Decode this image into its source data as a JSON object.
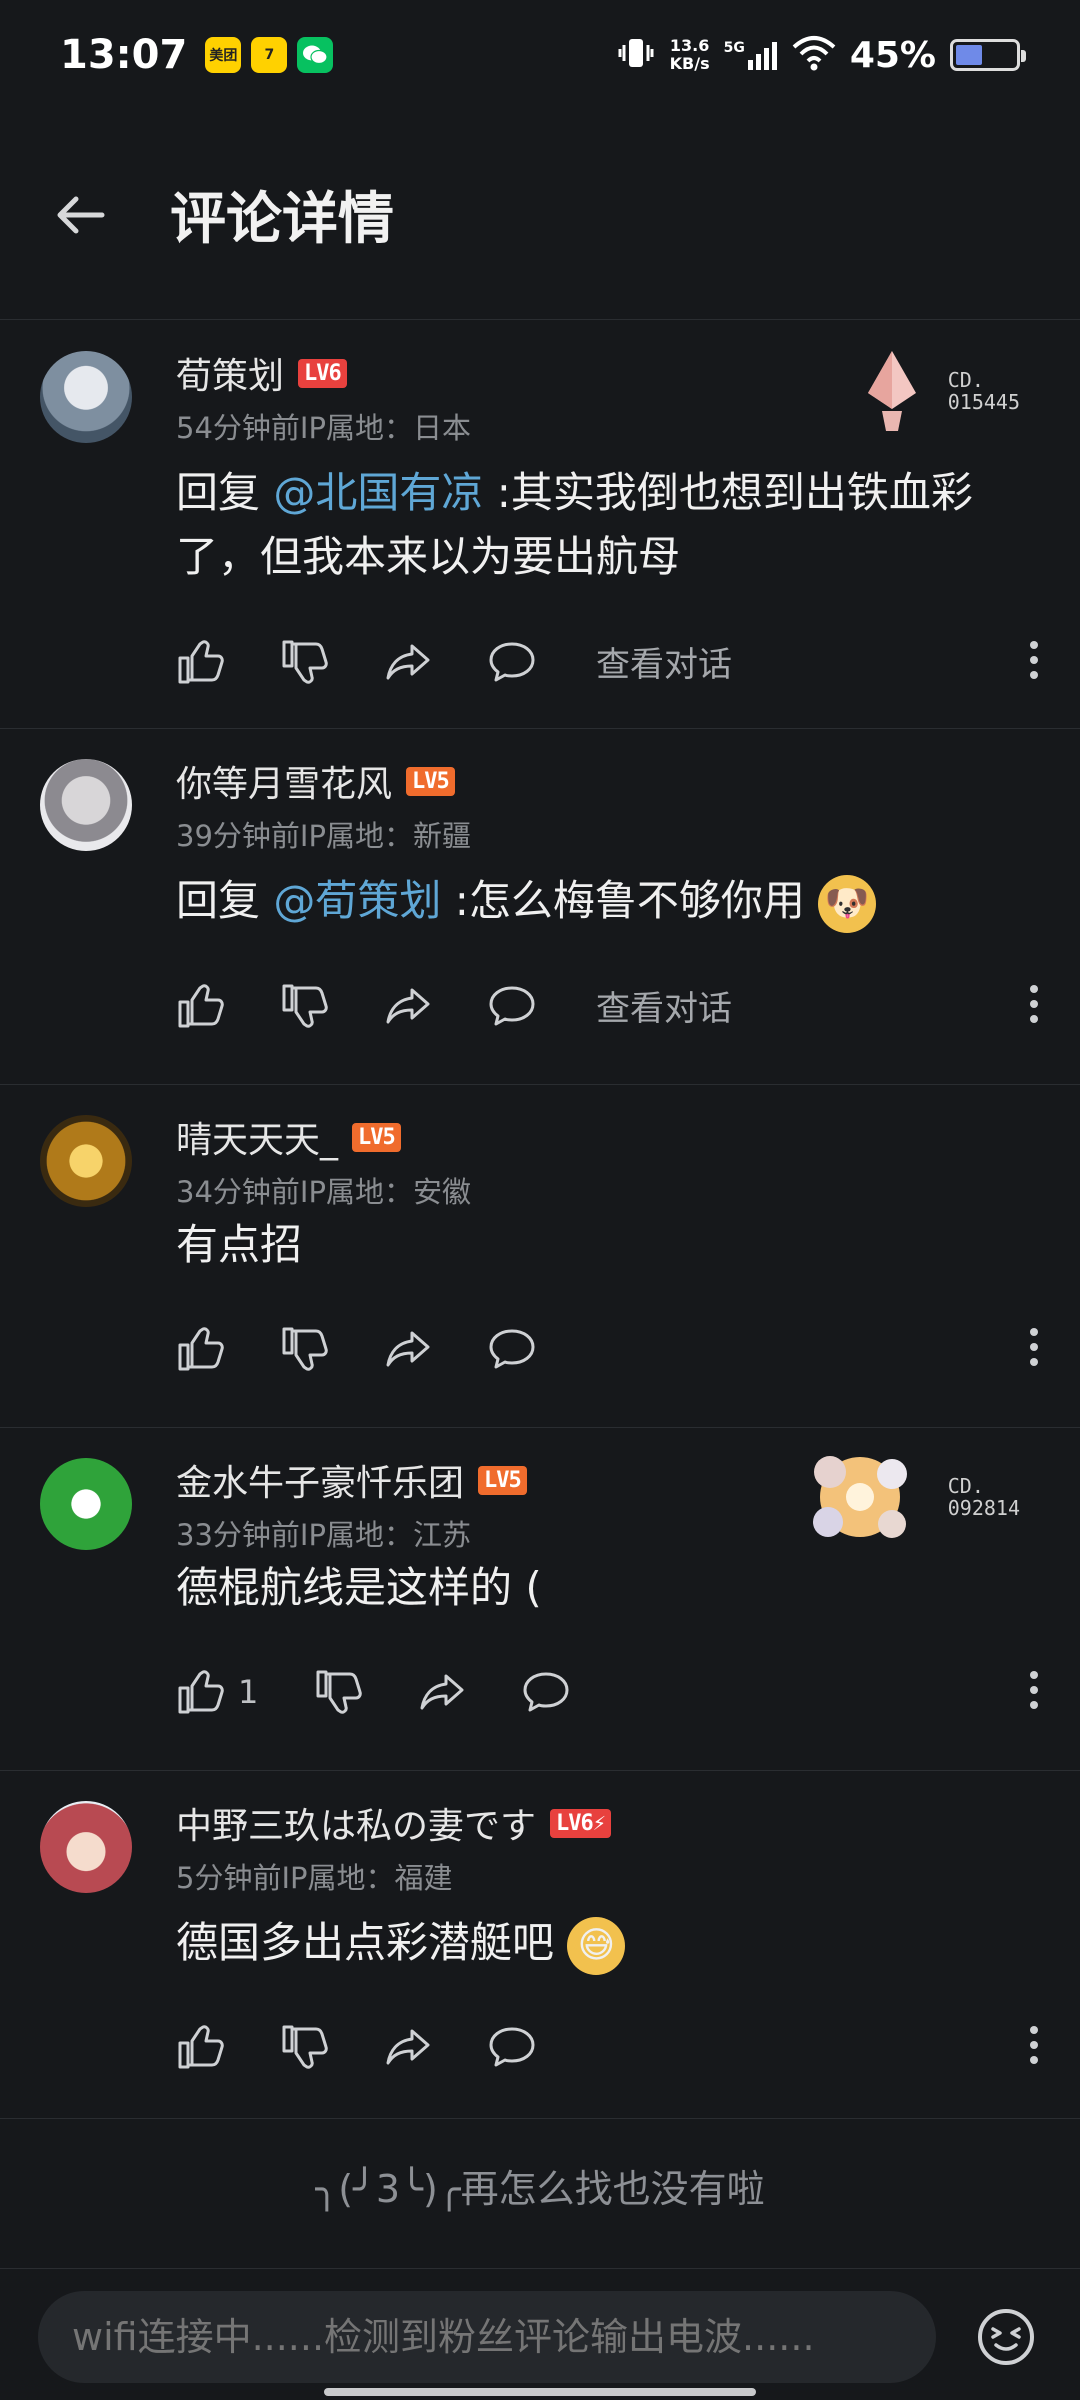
{
  "status_bar": {
    "time": "13:07",
    "app_icons": [
      {
        "name": "meituan-icon",
        "label": "美团",
        "color": "#ffd100"
      },
      {
        "name": "app-seven-icon",
        "label": "7",
        "color": "#ffd100"
      },
      {
        "name": "wechat-icon",
        "label": "",
        "color": "#07c160"
      }
    ],
    "net_speed": "13.6",
    "net_unit": "KB/s",
    "signal_label": "5G",
    "battery": "45%",
    "battery_level": 0.45
  },
  "header": {
    "title": "评论详情"
  },
  "comments": [
    {
      "username": "荀策划",
      "level": "LV6",
      "meta": "54分钟前IP属地：日本",
      "reply_prefix": "回复 ",
      "mention": "@北国有凉",
      "text": " :其实我倒也想到出铁血彩了，但我本来以为要出航母",
      "like_count": "",
      "view_conversation": "查看对话",
      "badge_code_1": "CD.",
      "badge_code_2": "015445",
      "avatar_color": "#8a9aa8"
    },
    {
      "username": "你等月雪花风",
      "level": "LV5",
      "meta": "39分钟前IP属地：新疆",
      "reply_prefix": "回复 ",
      "mention": "@荀策划",
      "text": " :怎么梅鲁不够你用",
      "emoji": "🐶",
      "view_conversation": "查看对话",
      "avatar_color": "#bfbfc4"
    },
    {
      "username": "晴天天天_",
      "level": "LV5",
      "meta": "34分钟前IP属地：安徽",
      "text": "有点招",
      "avatar_color": "#c7931f"
    },
    {
      "username": "金水牛子豪忏乐团",
      "level": "LV5",
      "meta": "33分钟前IP属地：江苏",
      "text": "德棍航线是这样的 (",
      "like_count": "1",
      "badge_code_1": "CD.",
      "badge_code_2": "092814",
      "avatar_color": "#2fa33a"
    },
    {
      "username": "中野三玖は私の妻です",
      "level": "LV6⚡",
      "meta": "5分钟前IP属地：福建",
      "text": "德国多出点彩潜艇吧",
      "emoji": "😅",
      "avatar_color": "#b84a52"
    }
  ],
  "end_tip": "╮(╯3╰)╭再怎么找也没有啦",
  "input": {
    "placeholder": "wifi连接中......检测到粉丝评论输出电波......"
  }
}
